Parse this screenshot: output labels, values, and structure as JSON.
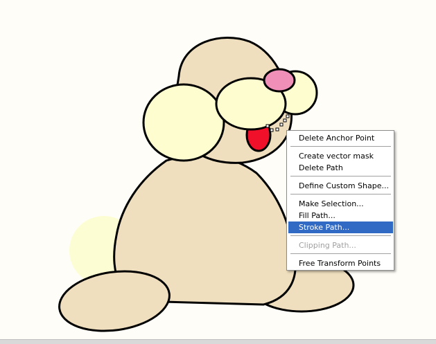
{
  "colors": {
    "background": "#fefdf7",
    "body_fill": "#efdfbe",
    "cream_fill": "#fdfdd0",
    "nose_fill": "#f090b8",
    "tongue_fill": "#f0102a",
    "outline": "#000000",
    "menu_highlight": "#316ac5"
  },
  "context_menu": {
    "items": [
      {
        "label": "Delete Anchor Point",
        "state": "normal"
      },
      {
        "label": "Create vector mask",
        "state": "normal"
      },
      {
        "label": "Delete Path",
        "state": "normal"
      },
      {
        "label": "Define Custom Shape...",
        "state": "normal"
      },
      {
        "label": "Make Selection...",
        "state": "normal"
      },
      {
        "label": "Fill Path...",
        "state": "normal"
      },
      {
        "label": "Stroke Path...",
        "state": "highlighted"
      },
      {
        "label": "Clipping Path...",
        "state": "disabled"
      },
      {
        "label": "Free Transform Points",
        "state": "normal"
      }
    ]
  }
}
